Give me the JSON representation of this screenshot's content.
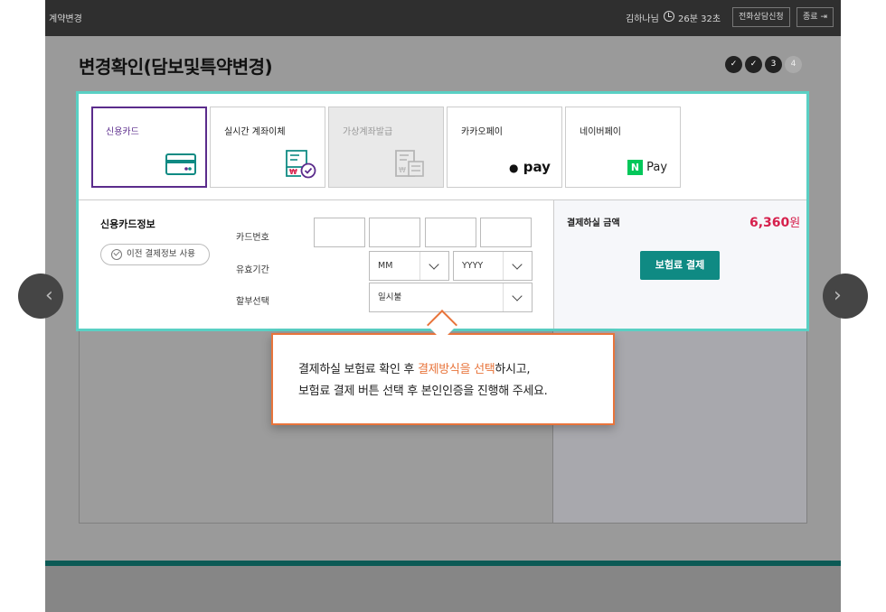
{
  "topbar": {
    "app_title": "계약변경",
    "user": "김하나님",
    "timer": "26분 32초",
    "consult_button": "전화상담신청",
    "exit_button": "종료"
  },
  "page": {
    "title": "변경확인(담보및특약변경)",
    "steps": [
      "✓",
      "✓",
      "3",
      "4"
    ],
    "current_step": 3
  },
  "payment": {
    "methods": [
      {
        "label": "신용카드",
        "icon": "credit-card-icon",
        "state": "selected"
      },
      {
        "label": "실시간 계좌이체",
        "icon": "bank-transfer-icon",
        "state": "normal"
      },
      {
        "label": "가상계좌발급",
        "icon": "virtual-account-icon",
        "state": "disabled"
      },
      {
        "label": "카카오페이",
        "icon": "kakaopay-logo",
        "state": "normal",
        "logo_text": "pay"
      },
      {
        "label": "네이버페이",
        "icon": "naverpay-logo",
        "state": "normal",
        "logo_text": "Pay",
        "logo_badge": "N"
      }
    ],
    "card_section_title": "신용카드정보",
    "prev_info_button": "이전 결제정보 사용",
    "fields": {
      "card_number_label": "카드번호",
      "expiry_label": "유효기간",
      "month_value": "MM",
      "year_value": "YYYY",
      "installment_label": "할부선택",
      "installment_value": "일시불"
    },
    "amount_label": "결제하실 금액",
    "amount_value": "6,360",
    "amount_unit": "원",
    "pay_button": "보험료 결제"
  },
  "tooltip": {
    "line1_before": "결제하실 보험료 확인 후 ",
    "line1_highlight": "결제방식을 선택",
    "line1_after": "하시고,",
    "line2": "보험료 결제 버튼 선택 후 본인인증을 진행해 주세요."
  },
  "colors": {
    "accent_teal": "#0f8a83",
    "highlight_border": "#5ad0c4",
    "selected_purple": "#5b2c8c",
    "amount_red": "#d6204c",
    "tooltip_orange": "#e8743b"
  }
}
